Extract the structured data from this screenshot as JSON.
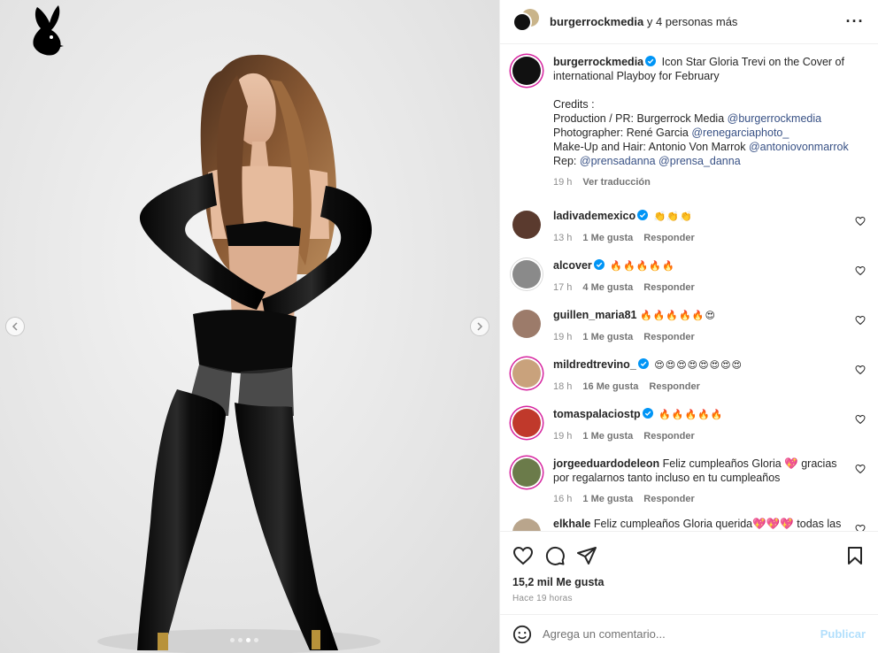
{
  "post": {
    "header_user": "burgerrockmedia",
    "header_suffix": "y 4 personas más",
    "more_icon": "more-horizontal-icon"
  },
  "caption": {
    "user": "burgerrockmedia",
    "text": "Icon Star Gloria Trevi on the Cover of international Playboy for February",
    "credits_title": "Credits :",
    "lines": [
      {
        "label": "Production / PR: Burgerrock Media ",
        "mention": "@burgerrockmedia"
      },
      {
        "label": "Photographer: René Garcia ",
        "mention": "@renegarciaphoto_"
      },
      {
        "label": "Make-Up and Hair: Antonio Von Marrok ",
        "mention": "@antoniovonmarrok"
      }
    ],
    "rep_label": "Rep: ",
    "rep_mentions": [
      "@prensadanna",
      "@prensa_danna"
    ],
    "time": "19 h",
    "translate": "Ver traducción"
  },
  "comments": [
    {
      "user": "ladivademexico",
      "verified": true,
      "text": "👏👏👏",
      "time": "13 h",
      "likes": "1 Me gusta",
      "reply": "Responder",
      "avatar_color": "#5a3a2e"
    },
    {
      "user": "alcover",
      "verified": true,
      "text": "🔥🔥🔥🔥🔥",
      "time": "17 h",
      "likes": "4 Me gusta",
      "reply": "Responder",
      "avatar_color": "#8a8a8a"
    },
    {
      "user": "guillen_maria81",
      "verified": false,
      "text": "🔥🔥🔥🔥🔥😍",
      "time": "19 h",
      "likes": "1 Me gusta",
      "reply": "Responder",
      "avatar_color": "#9c7b6a"
    },
    {
      "user": "mildredtrevino_",
      "verified": true,
      "text": "😍😍😍😍😍😍😍😍",
      "time": "18 h",
      "likes": "16 Me gusta",
      "reply": "Responder",
      "avatar_color": "#c9a27c"
    },
    {
      "user": "tomaspalaciostp",
      "verified": true,
      "text": "🔥🔥🔥🔥🔥",
      "time": "19 h",
      "likes": "1 Me gusta",
      "reply": "Responder",
      "avatar_color": "#c0392b"
    },
    {
      "user": "jorgeeduardodeleon",
      "verified": false,
      "text": "Feliz cumpleaños Gloria 💖 gracias por regalarnos tanto incluso en tu cumpleaños",
      "time": "16 h",
      "likes": "1 Me gusta",
      "reply": "Responder",
      "avatar_color": "#6b7b4a"
    },
    {
      "user": "elkhale",
      "verified": false,
      "text": "Feliz cumpleaños Gloria querida💖💖💖 todas las bendiciones del mundo. Muchas gracias por lo que tú nos has dado",
      "time": "",
      "likes": "",
      "reply": "",
      "avatar_color": "#b9a58c"
    }
  ],
  "actions": {
    "likes": "15,2 mil Me gusta",
    "time": "Hace 19 horas"
  },
  "add_comment": {
    "placeholder": "Agrega un comentario...",
    "publish": "Publicar"
  },
  "carousel": {
    "count": 4,
    "active": 2
  },
  "colors": {
    "link": "#00376b",
    "verified": "#0095f6",
    "publish": "#b2dffc",
    "muted": "#8e8e8e"
  }
}
